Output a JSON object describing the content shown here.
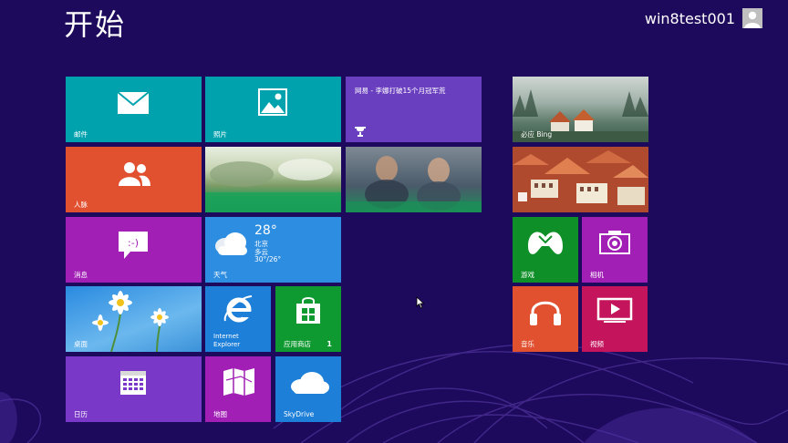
{
  "screen": {
    "title": "开始",
    "user": {
      "name": "win8test001"
    }
  },
  "tiles": {
    "mail": {
      "label": "邮件",
      "color": "#00a3ad"
    },
    "photos": {
      "label": "照片",
      "color": "#00a3ad"
    },
    "news": {
      "headline": "网易 - 李娜打破15个月冠军荒",
      "color": "#6a3fbf"
    },
    "people": {
      "label": "人脉",
      "color": "#e1502f"
    },
    "messaging": {
      "label": "消息",
      "color": "#a11fb5"
    },
    "weather": {
      "label": "天气",
      "temperature": "28°",
      "city": "北京",
      "condition": "多云",
      "range": "30°/26°",
      "color": "#2d8de0"
    },
    "desktop": {
      "label": "桌面",
      "color": "#2a8ae0"
    },
    "ie": {
      "label_line1": "Internet",
      "label_line2": "Explorer",
      "color": "#1e7fd8"
    },
    "store": {
      "label": "应用商店",
      "badge": "1",
      "color": "#0e9a30"
    },
    "calendar": {
      "label": "日历",
      "color": "#7a38c8"
    },
    "maps": {
      "label": "地图",
      "color": "#a11fb5"
    },
    "skydrive": {
      "label": "SkyDrive",
      "color": "#1e7fd8"
    },
    "bing": {
      "label": "必应 Bing"
    },
    "travel": {
      "label": ""
    },
    "games": {
      "label": "游戏",
      "color": "#0e8f27"
    },
    "camera": {
      "label": "相机",
      "color": "#a11fb5"
    },
    "music": {
      "label": "音乐",
      "color": "#e1502f"
    },
    "video": {
      "label": "视频",
      "color": "#c4145c"
    }
  }
}
